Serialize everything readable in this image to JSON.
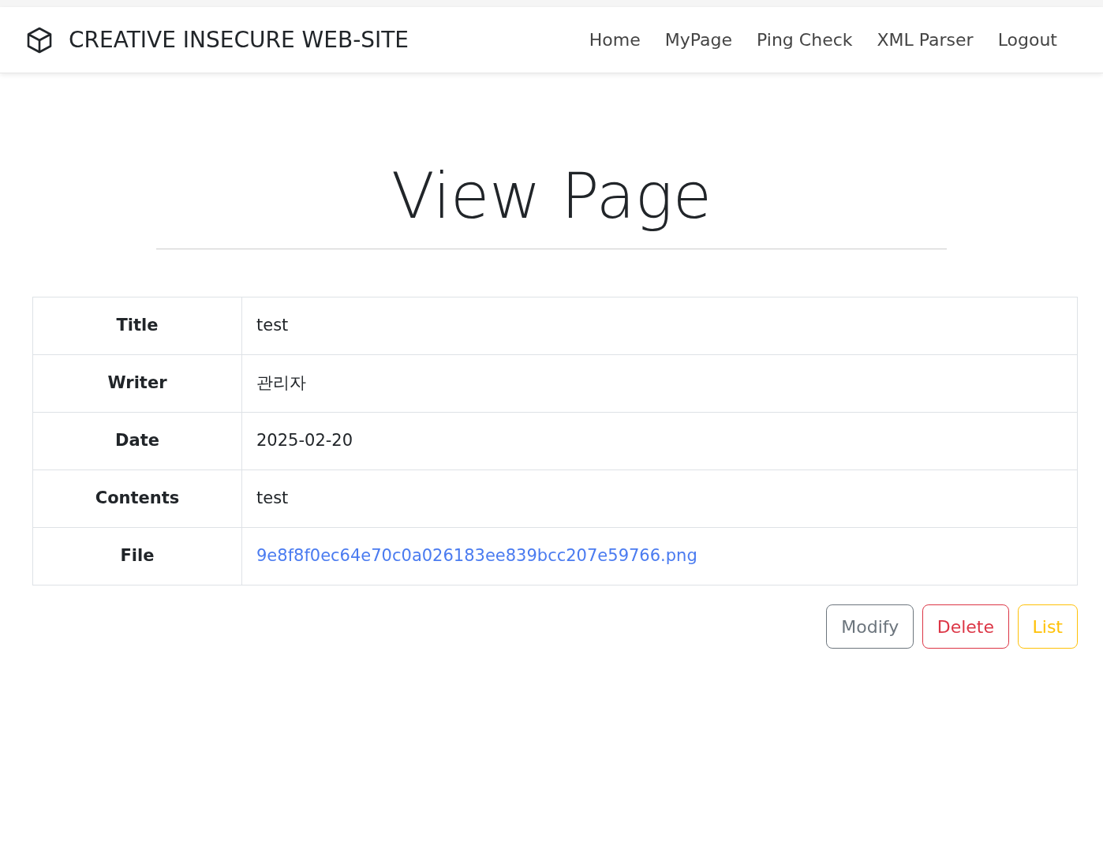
{
  "navbar": {
    "brand": "CREATIVE INSECURE WEB-SITE",
    "links": [
      "Home",
      "MyPage",
      "Ping Check",
      "XML Parser",
      "Logout"
    ]
  },
  "heading": "View Page",
  "details": [
    {
      "label": "Title",
      "value": "test",
      "kind": "text"
    },
    {
      "label": "Writer",
      "value": "관리자",
      "kind": "text"
    },
    {
      "label": "Date",
      "value": "2025-02-20",
      "kind": "text"
    },
    {
      "label": "Contents",
      "value": "test",
      "kind": "text"
    },
    {
      "label": "File",
      "value": "9e8f8f0ec64e70c0a026183ee839bcc207e59766.png",
      "kind": "link"
    }
  ],
  "buttons": [
    {
      "label": "Modify",
      "kind": "secondary"
    },
    {
      "label": "Delete",
      "kind": "danger"
    },
    {
      "label": "List",
      "kind": "warning"
    }
  ]
}
